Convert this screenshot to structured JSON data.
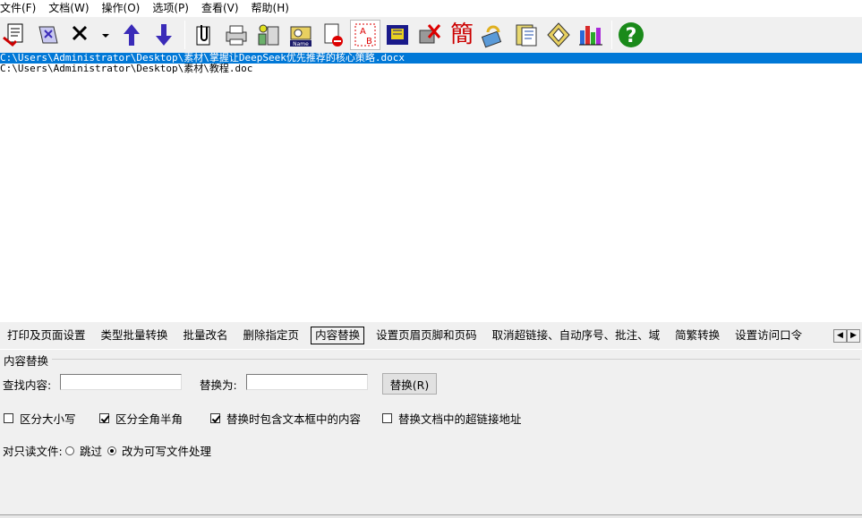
{
  "menu": [
    {
      "label": "文件(F)"
    },
    {
      "label": "文档(W)"
    },
    {
      "label": "操作(O)"
    },
    {
      "label": "选项(P)"
    },
    {
      "label": "查看(V)"
    },
    {
      "label": "帮助(H)"
    }
  ],
  "toolbar": {
    "traditional_char": "簡",
    "name_badge": "Name",
    "ab_a": "A",
    "ab_b": "B",
    "help_glyph": "?",
    "colors": {
      "accent": "#0078d7",
      "arrow": "#3a2bb8",
      "help_green": "#1a8a1a",
      "red": "#cc0000"
    }
  },
  "files": [
    {
      "path": "C:\\Users\\Administrator\\Desktop\\素材\\掌握让DeepSeek优先推荐的核心策略.docx",
      "selected": true
    },
    {
      "path": "C:\\Users\\Administrator\\Desktop\\素材\\教程.doc",
      "selected": false
    }
  ],
  "tabs": [
    {
      "label": "打印及页面设置",
      "active": false
    },
    {
      "label": "类型批量转换",
      "active": false
    },
    {
      "label": "批量改名",
      "active": false
    },
    {
      "label": "删除指定页",
      "active": false
    },
    {
      "label": "内容替换",
      "active": true
    },
    {
      "label": "设置页眉页脚和页码",
      "active": false
    },
    {
      "label": "取消超链接、自动序号、批注、域",
      "active": false
    },
    {
      "label": "简繁转换",
      "active": false
    },
    {
      "label": "设置访问口令",
      "active": false
    }
  ],
  "panel": {
    "group_title": "内容替换",
    "find_label": "查找内容:",
    "find_value": "",
    "replace_label": "替换为:",
    "replace_value": "",
    "replace_button": "替换(R)",
    "options": [
      {
        "label": "区分大小写",
        "checked": false
      },
      {
        "label": "区分全角半角",
        "checked": true
      },
      {
        "label": "替换时包含文本框中的内容",
        "checked": true
      },
      {
        "label": "替换文档中的超链接地址",
        "checked": false
      }
    ],
    "readonly_label": "对只读文件:",
    "readonly_options": [
      {
        "label": "跳过",
        "selected": false
      },
      {
        "label": "改为可写文件处理",
        "selected": true
      }
    ]
  }
}
